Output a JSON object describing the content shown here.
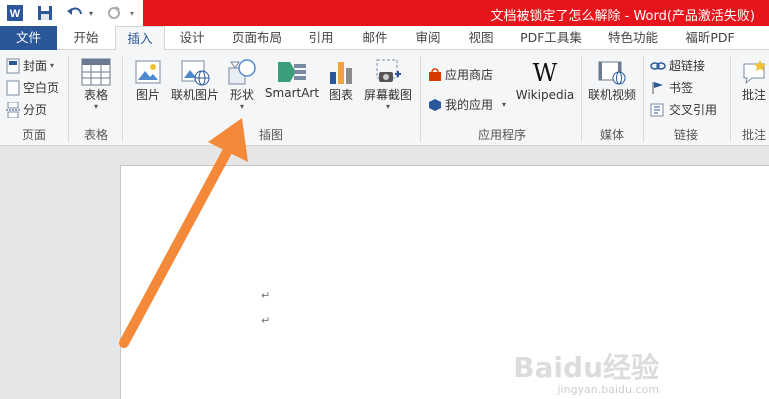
{
  "titlebar": {
    "title": "文档被锁定了怎么解除 - Word(产品激活失败)",
    "brand_color": "#e8141b"
  },
  "tabs": [
    {
      "label": "文件"
    },
    {
      "label": "开始"
    },
    {
      "label": "插入"
    },
    {
      "label": "设计"
    },
    {
      "label": "页面布局"
    },
    {
      "label": "引用"
    },
    {
      "label": "邮件"
    },
    {
      "label": "审阅"
    },
    {
      "label": "视图"
    },
    {
      "label": "PDF工具集"
    },
    {
      "label": "特色功能"
    },
    {
      "label": "福昕PDF"
    }
  ],
  "ribbon": {
    "pages": {
      "cover": "封面",
      "blank": "空白页",
      "break": "分页",
      "group": "页面"
    },
    "tables": {
      "table": "表格",
      "group": "表格"
    },
    "illustrations": {
      "picture": "图片",
      "online_picture": "联机图片",
      "shapes": "形状",
      "smartart": "SmartArt",
      "chart": "图表",
      "screenshot": "屏幕截图",
      "group": "插图"
    },
    "apps": {
      "store": "应用商店",
      "my_apps": "我的应用",
      "wikipedia": "Wikipedia",
      "group": "应用程序"
    },
    "media": {
      "online_video": "联机视频",
      "group": "媒体"
    },
    "links": {
      "hyperlink": "超链接",
      "bookmark": "书签",
      "cross_ref": "交叉引用",
      "group": "链接"
    },
    "comments": {
      "comment": "批注",
      "group": "批注"
    }
  },
  "document": {
    "para_mark": "↵"
  },
  "watermark": {
    "logo": "Baidu经验",
    "url": "jingyan.baidu.com"
  },
  "annotation_color": "#f4893a"
}
